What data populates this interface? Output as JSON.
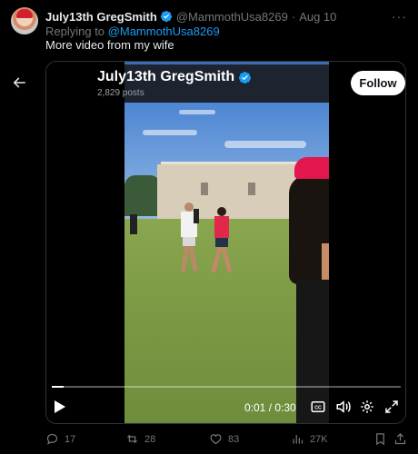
{
  "tweet": {
    "display_name": "July13th GregSmith",
    "handle": "@MammothUsa8269",
    "separator": "·",
    "date": "Aug 10",
    "replying_prefix": "Replying to",
    "replying_handle": "@MammothUsa8269",
    "text": "More video from my wife",
    "more": "···"
  },
  "media": {
    "channel_name": "July13th GregSmith",
    "posts_count": "2,829 posts",
    "follow_label": "Follow",
    "time_display": "0:01 / 0:30",
    "progress_fraction": 0.033
  },
  "actions": {
    "replies": "17",
    "reposts": "28",
    "likes": "83",
    "views": "27K"
  },
  "colors": {
    "accent": "#1d9bf0",
    "background": "#000000",
    "muted": "#71767b",
    "repost_green": "#00ba7c"
  }
}
